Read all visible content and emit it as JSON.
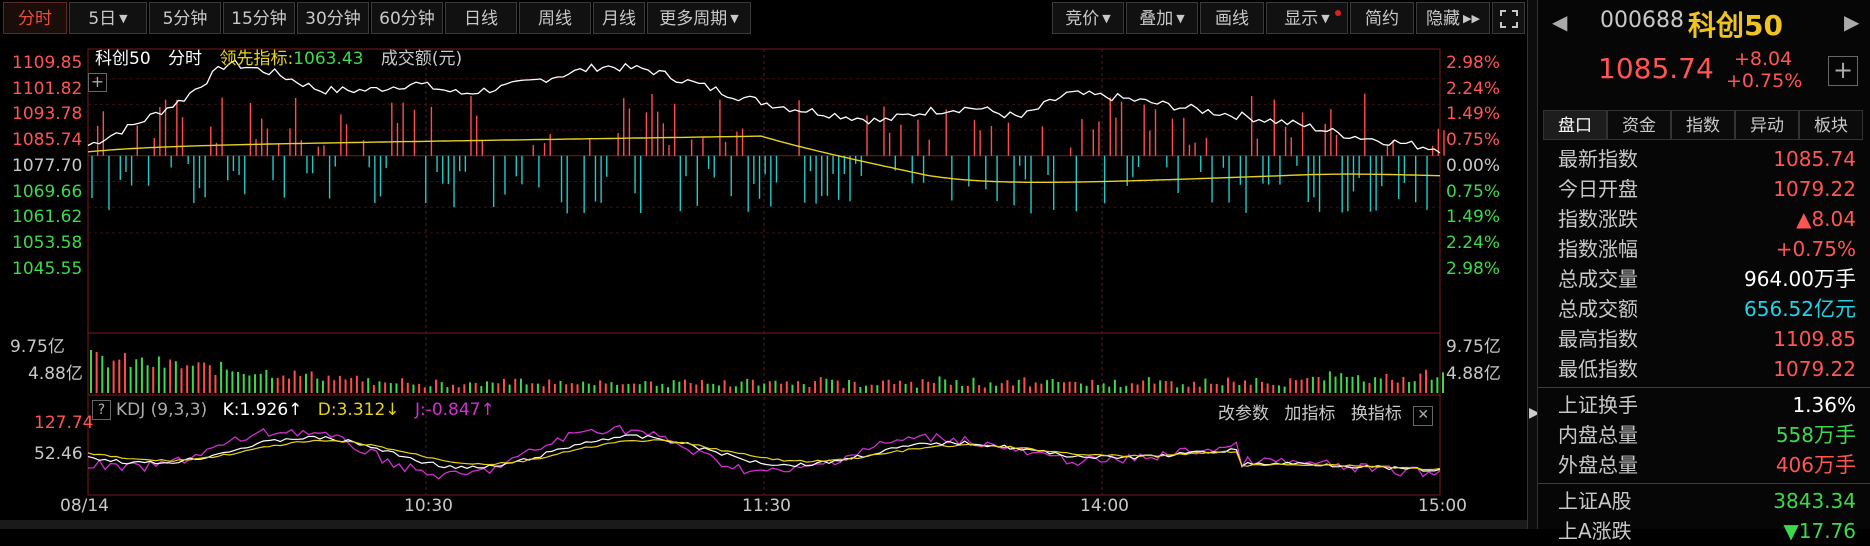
{
  "toolbar": {
    "period_tabs": [
      "分时",
      "5日",
      "5分钟",
      "15分钟",
      "30分钟",
      "60分钟",
      "日线",
      "周线",
      "月线",
      "更多周期"
    ],
    "right_buttons": [
      "竞价",
      "叠加",
      "画线",
      "显示",
      "简约",
      "隐藏"
    ]
  },
  "chart": {
    "legend_name": "科创50",
    "legend_mode": "分时",
    "legend_leader_label": "领先指标:",
    "legend_leader_value": "1063.43",
    "legend_volume": "成交额(元)",
    "price_axis": [
      "1109.85",
      "1101.82",
      "1093.78",
      "1085.74",
      "1077.70",
      "1069.66",
      "1061.62",
      "1053.58",
      "1045.55"
    ],
    "pct_axis": [
      "2.98%",
      "2.24%",
      "1.49%",
      "0.75%",
      "0.00%",
      "0.75%",
      "1.49%",
      "2.24%",
      "2.98%"
    ],
    "vol_axis": [
      "9.75亿",
      "4.88亿"
    ],
    "kdj_axis": [
      "127.74",
      "52.46"
    ],
    "x_labels": [
      "08/14",
      "10:30",
      "11:30",
      "14:00",
      "15:00"
    ],
    "kdj": {
      "label": "KDJ (9,3,3)",
      "k": "K:1.926↑",
      "d": "D:3.312↓",
      "j": "J:-0.847↑"
    },
    "kdj_buttons": [
      "改参数",
      "加指标",
      "换指标"
    ]
  },
  "colors": {
    "up": "#ff4d4d",
    "down": "#22c9c9",
    "price_line": "#ffffff",
    "avg_line": "#e6d21a",
    "j_line": "#d02ed0"
  },
  "quote": {
    "code": "000688",
    "name": "科创50",
    "price": "1085.74",
    "change": "+8.04",
    "pct": "+0.75%"
  },
  "panel_tabs": [
    "盘口",
    "资金",
    "指数",
    "异动",
    "板块"
  ],
  "stats": [
    {
      "label": "最新指数",
      "value": "1085.74",
      "color": "#ff5555"
    },
    {
      "label": "今日开盘",
      "value": "1079.22",
      "color": "#ff5555"
    },
    {
      "label": "指数涨跌",
      "value": "▲8.04",
      "color": "#ff5555"
    },
    {
      "label": "指数涨幅",
      "value": "+0.75%",
      "color": "#ff5555"
    },
    {
      "label": "总成交量",
      "value": "964.00",
      "unit": "万手",
      "color": "#ffffff"
    },
    {
      "label": "总成交额",
      "value": "656.52",
      "unit": "亿元",
      "color": "#22d3e6"
    },
    {
      "label": "最高指数",
      "value": "1109.85",
      "color": "#ff5555"
    },
    {
      "label": "最低指数",
      "value": "1079.22",
      "color": "#ff5555"
    }
  ],
  "stats2": [
    {
      "label": "上证换手",
      "value": "1.36%",
      "color": "#ffffff"
    },
    {
      "label": "内盘总量",
      "value": "558",
      "unit": "万手",
      "color": "#3ed84e"
    },
    {
      "label": "外盘总量",
      "value": "406",
      "unit": "万手",
      "color": "#ff5555"
    }
  ],
  "stats3": [
    {
      "label": "上证A股",
      "value": "3843.34",
      "color": "#3ed84e"
    },
    {
      "label": "上A涨跌",
      "value": "▼17.76",
      "color": "#3ed84e"
    }
  ]
}
